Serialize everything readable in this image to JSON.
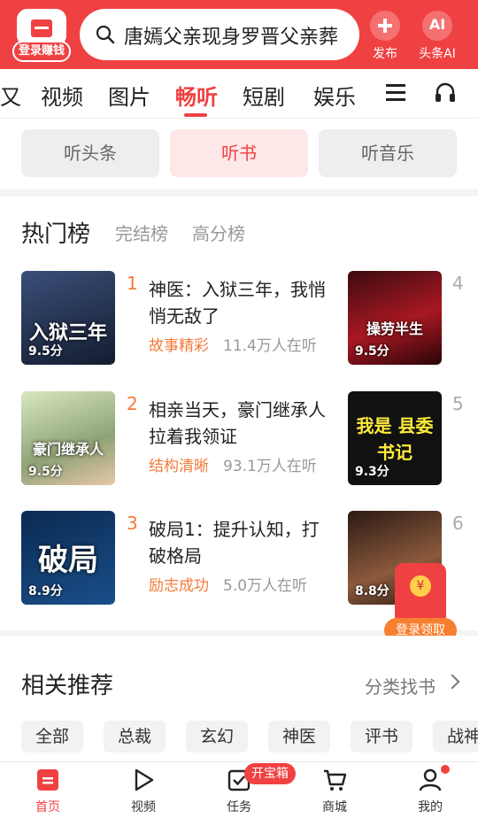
{
  "header": {
    "logo_label": "登录赚钱",
    "search_text": "唐嫣父亲现身罗晋父亲葬",
    "publish_label": "发布",
    "ai_icon_text": "AI",
    "ai_label": "头条AI"
  },
  "tabs": [
    "又",
    "视频",
    "图片",
    "畅听",
    "短剧",
    "娱乐"
  ],
  "active_tab": "畅听",
  "subtabs": [
    "听头条",
    "听书",
    "听音乐"
  ],
  "active_subtab": "听书",
  "rank": {
    "tabs": [
      "热门榜",
      "完结榜",
      "高分榜"
    ],
    "items": [
      {
        "rank": "1",
        "title": "神医：入狱三年，我悄悄无敌了",
        "cover_text": "入狱三年",
        "score": "9.5分",
        "tag": "故事精彩",
        "listeners": "11.4万人在听"
      },
      {
        "rank": "2",
        "title": "相亲当天，豪门继承人拉着我领证",
        "cover_text": "豪门继承人",
        "score": "9.5分",
        "tag": "结构清晰",
        "listeners": "93.1万人在听"
      },
      {
        "rank": "3",
        "title": "破局1：提升认知，打破格局",
        "cover_text": "破局",
        "score": "8.9分",
        "tag": "励志成功",
        "listeners": "5.0万人在听"
      }
    ],
    "side_items": [
      {
        "rank": "4",
        "score": "9.5分",
        "cover_text": "操劳半生"
      },
      {
        "rank": "5",
        "score": "9.3分",
        "cover_text": "我是 县委书记"
      },
      {
        "rank": "6",
        "score": "8.8分",
        "cover_text": ""
      }
    ]
  },
  "float_banner": {
    "label": "登录领取"
  },
  "recommend": {
    "title": "相关推荐",
    "link": "分类找书",
    "chips": [
      "全部",
      "总裁",
      "玄幻",
      "神医",
      "评书",
      "战神"
    ]
  },
  "bottom_nav": {
    "items": [
      "首页",
      "视频",
      "任务",
      "商城",
      "我的"
    ],
    "active": "首页",
    "task_badge": "开宝箱"
  },
  "colors": {
    "brand": "#f04142",
    "accent": "#f47b3a"
  }
}
